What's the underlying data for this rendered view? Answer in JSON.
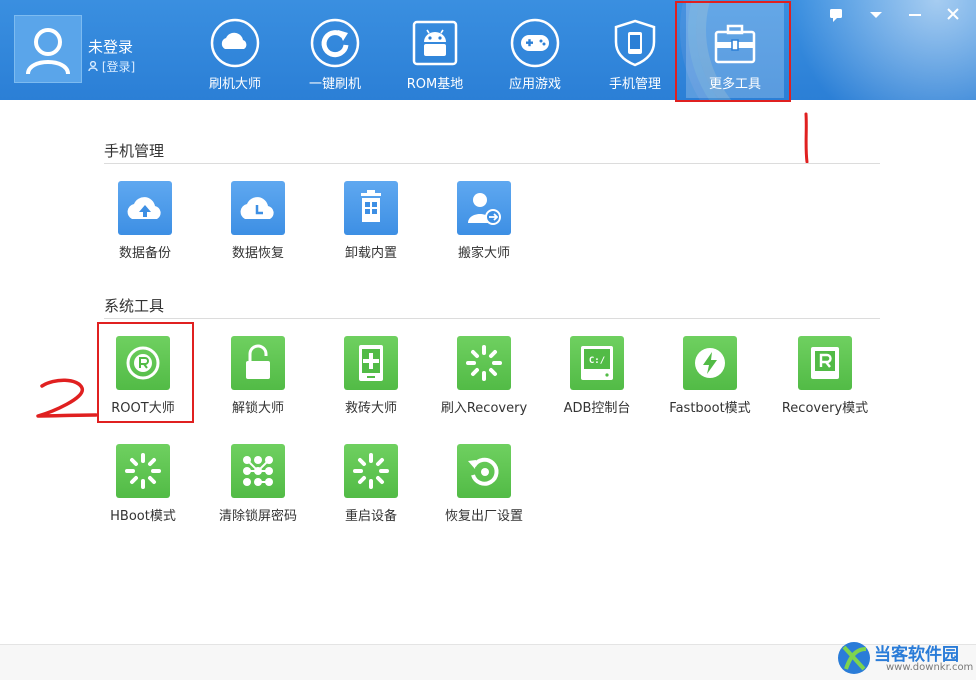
{
  "user": {
    "name": "未登录",
    "login_link": "[登录]"
  },
  "nav": [
    {
      "label": "刷机大师",
      "icon": "cloud-icon"
    },
    {
      "label": "一键刷机",
      "icon": "refresh-icon"
    },
    {
      "label": "ROM基地",
      "icon": "android-icon"
    },
    {
      "label": "应用游戏",
      "icon": "gamepad-icon"
    },
    {
      "label": "手机管理",
      "icon": "phone-shield-icon"
    },
    {
      "label": "更多工具",
      "icon": "toolbox-icon",
      "active": true
    }
  ],
  "sections": {
    "phone_management": {
      "title": "手机管理",
      "tools": [
        "数据备份",
        "数据恢复",
        "卸载内置",
        "搬家大师"
      ]
    },
    "system_tools": {
      "title": "系统工具",
      "tools": [
        "ROOT大师",
        "解锁大师",
        "救砖大师",
        "刷入Recovery",
        "ADB控制台",
        "Fastboot模式",
        "Recovery模式",
        "HBoot模式",
        "清除锁屏密码",
        "重启设备",
        "恢复出厂设置"
      ]
    }
  },
  "adb_icon_text": "C:/",
  "annotations": {
    "mark_1": "1",
    "mark_2": "2"
  },
  "watermark": {
    "text": "当客软件园",
    "sub": "www.downkr.com"
  },
  "colors": {
    "header": "#2b7fd6",
    "tool_blue": "#3d8fe4",
    "tool_green": "#52bb46",
    "annotation": "#e02020"
  }
}
